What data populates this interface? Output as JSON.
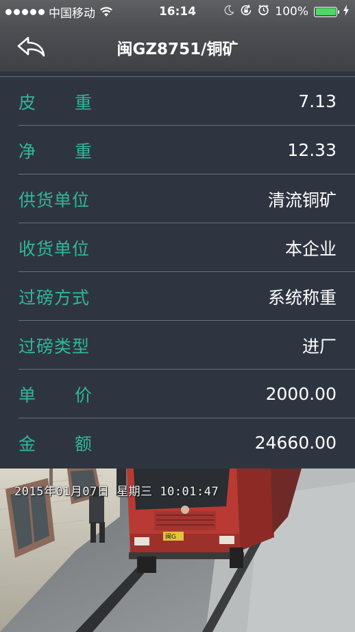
{
  "status_bar": {
    "carrier": "中国移动",
    "time": "16:14",
    "battery": "100%",
    "battery_level": 1.0,
    "signal_bars": 5,
    "icons": [
      "wifi-icon",
      "moon-icon",
      "rotation-lock-icon",
      "alarm-icon",
      "battery-icon",
      "charging-icon"
    ]
  },
  "nav": {
    "title": "闽GZ8751/铜矿",
    "back_icon": "back-arrow-icon"
  },
  "details": [
    {
      "label_a": "皮",
      "label_b": "重",
      "value": "7.13"
    },
    {
      "label_a": "净",
      "label_b": "重",
      "value": "12.33"
    },
    {
      "label": "供货单位",
      "value": "清流铜矿"
    },
    {
      "label": "收货单位",
      "value": "本企业"
    },
    {
      "label": "过磅方式",
      "value": "系统称重"
    },
    {
      "label": "过磅类型",
      "value": "进厂"
    },
    {
      "label_a": "单",
      "label_b": "价",
      "value": "2000.00"
    },
    {
      "label_a": "金",
      "label_b": "额",
      "value": "24660.00"
    }
  ],
  "photo": {
    "timestamp": "2015年01月07日 星期三 10:01:47",
    "plate": "闽G"
  },
  "colors": {
    "background": "#2f3540",
    "label": "#2fb89a",
    "value": "#ffffff",
    "divider": "#6b7079",
    "nav": "#45474b",
    "battery": "#4cd964"
  }
}
